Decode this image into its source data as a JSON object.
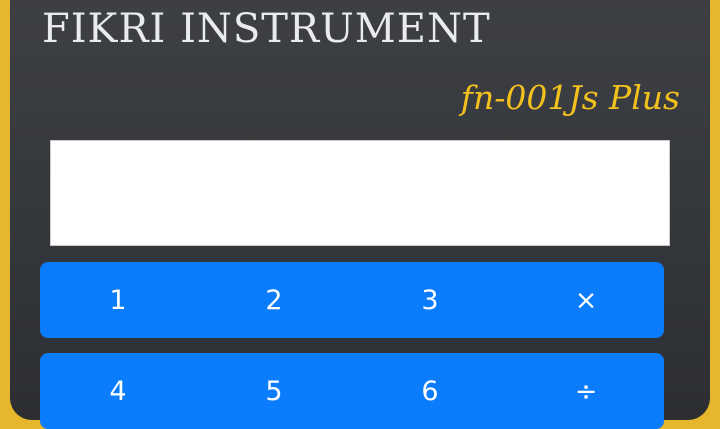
{
  "calculator": {
    "brand": "FIKRI INSTRUMENT",
    "model": "fn-001Js Plus",
    "display_value": "",
    "keypad": {
      "row1": [
        "1",
        "2",
        "3",
        "×"
      ],
      "row2": [
        "4",
        "5",
        "6",
        "÷"
      ]
    }
  },
  "colors": {
    "bezel": "#e6b62c",
    "body": "#3a3c40",
    "brand_text": "#e9ebef",
    "model_text": "#f2c11d",
    "key_background": "#0b7cfb",
    "key_text": "#ffffff",
    "display_background": "#ffffff"
  }
}
